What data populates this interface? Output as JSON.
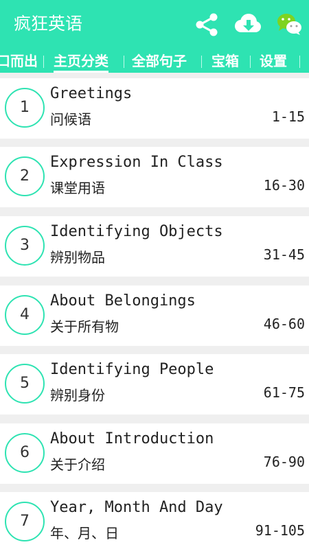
{
  "app": {
    "title": "疯狂英语"
  },
  "icons": {
    "share": "share-icon",
    "download": "cloud-download-icon",
    "wechat": "wechat-icon"
  },
  "colors": {
    "accent": "#2ee3b2",
    "text": "#222222",
    "background": "#efefef"
  },
  "tabs": [
    {
      "label": "脱口而出"
    },
    {
      "label": "主页分类",
      "active": true
    },
    {
      "label": "全部句子"
    },
    {
      "label": "宝箱"
    },
    {
      "label": "设置"
    }
  ],
  "lessons": [
    {
      "num": "1",
      "en": "Greetings",
      "zh": "问候语",
      "range": "1-15"
    },
    {
      "num": "2",
      "en": "Expression In Class",
      "zh": "课堂用语",
      "range": "16-30"
    },
    {
      "num": "3",
      "en": "Identifying Objects",
      "zh": "辨别物品",
      "range": "31-45"
    },
    {
      "num": "4",
      "en": "About Belongings",
      "zh": "关于所有物",
      "range": "46-60"
    },
    {
      "num": "5",
      "en": "Identifying People",
      "zh": "辨别身份",
      "range": "61-75"
    },
    {
      "num": "6",
      "en": "About Introduction",
      "zh": "关于介绍",
      "range": "76-90"
    },
    {
      "num": "7",
      "en": "Year, Month And Day",
      "zh": "年、月、日",
      "range": "91-105"
    }
  ]
}
